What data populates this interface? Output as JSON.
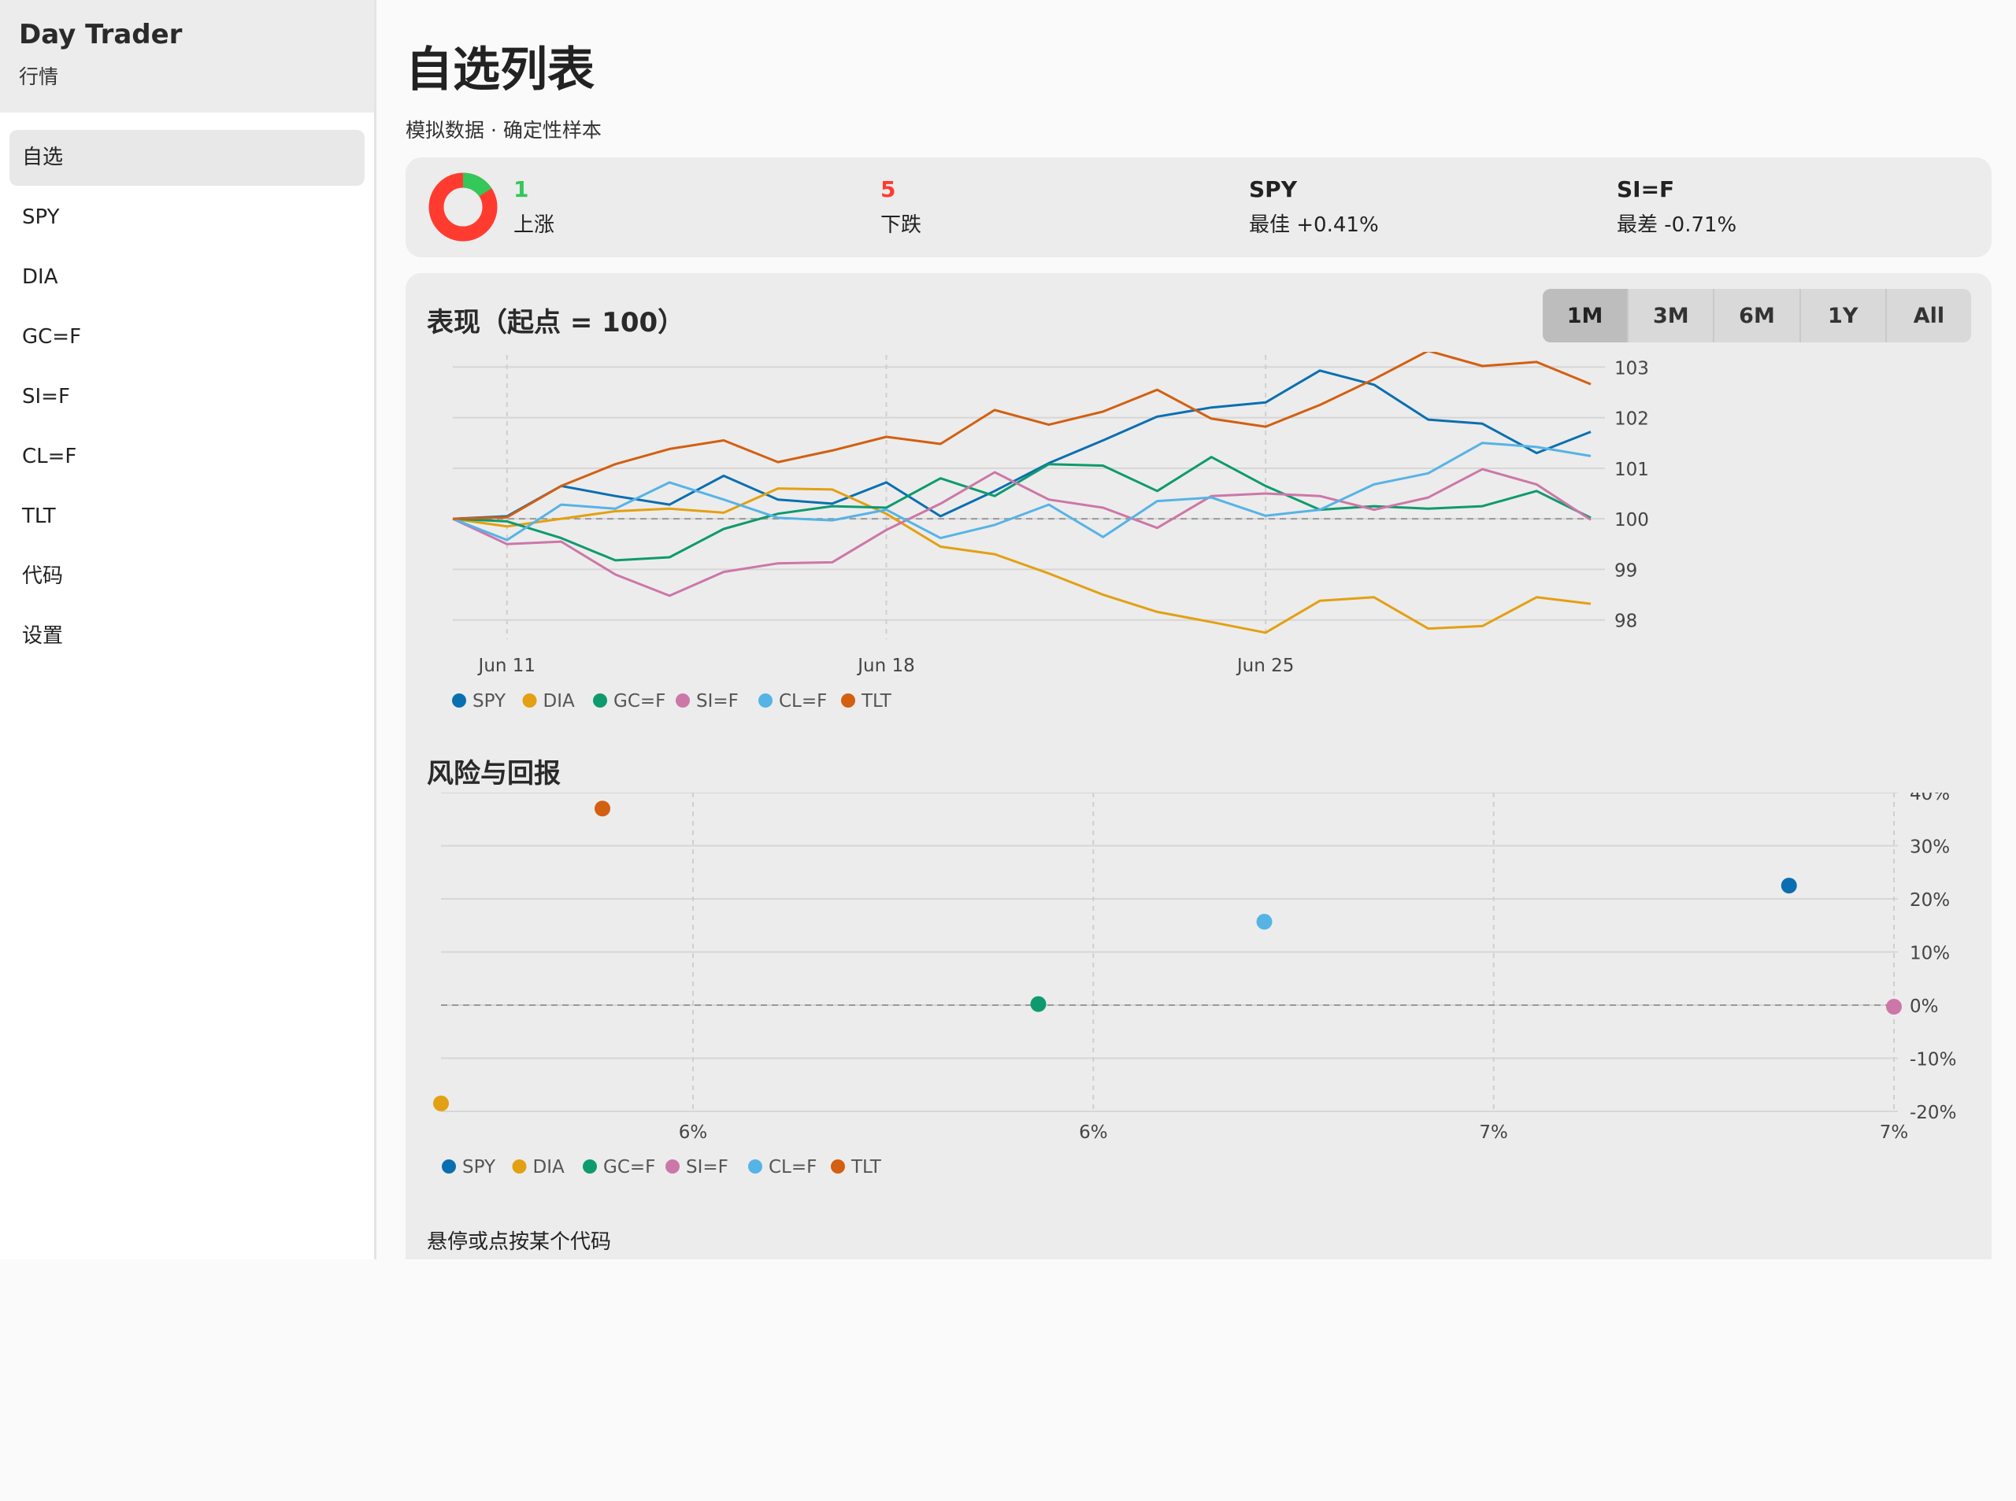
{
  "app": {
    "title": "Day Trader",
    "subtitle": "行情"
  },
  "sidebar": {
    "items": [
      {
        "label": "自选",
        "active": true
      },
      {
        "label": "SPY"
      },
      {
        "label": "DIA"
      },
      {
        "label": "GC=F"
      },
      {
        "label": "SI=F"
      },
      {
        "label": "CL=F"
      },
      {
        "label": "TLT"
      },
      {
        "label": "代码"
      },
      {
        "label": "设置"
      }
    ]
  },
  "page": {
    "title": "自选列表",
    "subtitle": "模拟数据 · 确定性样本"
  },
  "summary": {
    "up": {
      "value": "1",
      "label": "上涨"
    },
    "down": {
      "value": "5",
      "label": "下跌"
    },
    "best": {
      "ticker": "SPY",
      "label": "最佳 +0.41%"
    },
    "worst": {
      "ticker": "SI=F",
      "label": "最差 -0.71%"
    },
    "colors": {
      "up": "#34c759",
      "down": "#ff3b30"
    }
  },
  "performance": {
    "title": "表现（起点 = 100）",
    "ranges": [
      "1M",
      "3M",
      "6M",
      "1Y",
      "All"
    ],
    "active_range": "1M"
  },
  "risk": {
    "title": "风险与回报"
  },
  "hint": "悬停或点按某个代码",
  "series_colors": {
    "SPY": "#0a6fb0",
    "DIA": "#e3a012",
    "GC=F": "#0e9a6e",
    "SI=F": "#cc77a7",
    "CL=F": "#56b3e6",
    "TLT": "#d35f10"
  },
  "chart_data": [
    {
      "type": "line",
      "title": "表现（起点 = 100）",
      "x_tick_labels": [
        "Jun 11",
        "Jun 18",
        "Jun 25"
      ],
      "x_tick_dates": [
        "2024-06-11",
        "2024-06-18",
        "2024-06-25"
      ],
      "x": [
        "2024-06-10",
        "2024-06-11",
        "2024-06-12",
        "2024-06-13",
        "2024-06-14",
        "2024-06-15",
        "2024-06-16",
        "2024-06-17",
        "2024-06-18",
        "2024-06-19",
        "2024-06-20",
        "2024-06-21",
        "2024-06-22",
        "2024-06-23",
        "2024-06-24",
        "2024-06-25",
        "2024-06-26",
        "2024-06-27",
        "2024-06-28",
        "2024-06-29",
        "2024-06-30",
        "2024-07-01"
      ],
      "ylim": [
        97.7,
        103.3
      ],
      "yticks": [
        98,
        99,
        100,
        101,
        102,
        103
      ],
      "reference_line": 100,
      "grid": true,
      "legend": "bottom-left",
      "series": [
        {
          "name": "SPY",
          "values": [
            100,
            100.05,
            100.65,
            100.45,
            100.28,
            100.85,
            100.38,
            100.3,
            100.72,
            100.05,
            100.55,
            101.1,
            101.55,
            102.02,
            102.2,
            102.3,
            102.93,
            102.65,
            101.96,
            101.88,
            101.3,
            101.72
          ]
        },
        {
          "name": "DIA",
          "values": [
            100,
            99.85,
            100.0,
            100.15,
            100.2,
            100.12,
            100.6,
            100.58,
            100.1,
            99.45,
            99.3,
            98.92,
            98.5,
            98.16,
            97.96,
            97.75,
            98.38,
            98.45,
            97.83,
            97.88,
            98.45,
            98.32
          ]
        },
        {
          "name": "GC=F",
          "values": [
            100,
            99.95,
            99.62,
            99.18,
            99.24,
            99.8,
            100.1,
            100.25,
            100.22,
            100.8,
            100.45,
            101.08,
            101.05,
            100.55,
            101.22,
            100.65,
            100.18,
            100.25,
            100.2,
            100.25,
            100.55,
            100.02
          ]
        },
        {
          "name": "SI=F",
          "values": [
            100,
            99.5,
            99.55,
            98.9,
            98.48,
            98.95,
            99.12,
            99.14,
            99.78,
            100.3,
            100.92,
            100.38,
            100.22,
            99.82,
            100.45,
            100.5,
            100.45,
            100.18,
            100.42,
            100.98,
            100.68,
            99.98
          ]
        },
        {
          "name": "CL=F",
          "values": [
            100,
            99.58,
            100.28,
            100.2,
            100.72,
            100.38,
            100.02,
            99.97,
            100.18,
            99.62,
            99.88,
            100.28,
            99.64,
            100.35,
            100.42,
            100.06,
            100.18,
            100.68,
            100.9,
            101.5,
            101.42,
            101.24
          ]
        },
        {
          "name": "TLT",
          "values": [
            100,
            100.03,
            100.65,
            101.08,
            101.38,
            101.55,
            101.12,
            101.35,
            101.62,
            101.48,
            102.15,
            101.86,
            102.12,
            102.55,
            101.98,
            101.82,
            102.25,
            102.76,
            103.32,
            103.02,
            103.1,
            102.66
          ]
        }
      ]
    },
    {
      "type": "scatter",
      "title": "风险与回报",
      "x_tick_labels": [
        "6%",
        "6%",
        "7%",
        "7%"
      ],
      "y_tick_labels": [
        "40%",
        "30%",
        "20%",
        "10%",
        "0%",
        "-10%",
        "-20%"
      ],
      "xlim": [
        5.3,
        7.1
      ],
      "ylim": [
        -20,
        40
      ],
      "reference_line": 0,
      "grid": true,
      "legend": "bottom-left",
      "points": [
        {
          "name": "SPY",
          "x": 6.97,
          "y": 22.5
        },
        {
          "name": "DIA",
          "x": 5.3,
          "y": -18.5
        },
        {
          "name": "GC=F",
          "x": 6.04,
          "y": 0.2
        },
        {
          "name": "SI=F",
          "x": 7.1,
          "y": -0.3
        },
        {
          "name": "CL=F",
          "x": 6.32,
          "y": 15.7
        },
        {
          "name": "TLT",
          "x": 5.5,
          "y": 37
        }
      ]
    }
  ]
}
